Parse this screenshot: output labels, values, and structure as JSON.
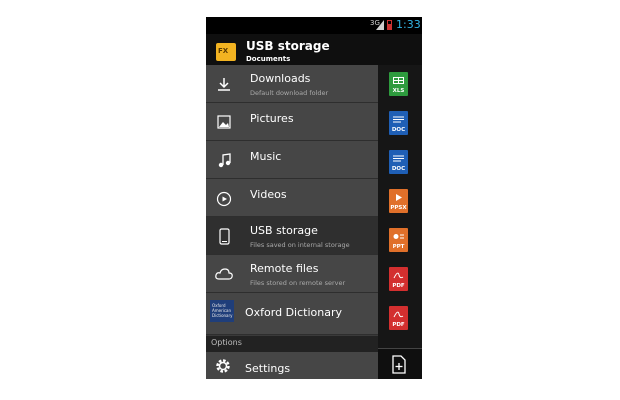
{
  "status_bar": {
    "signal": "3G",
    "time": "1:33"
  },
  "action_bar": {
    "app_icon_label": "FX",
    "title": "USB storage",
    "subtitle": "Documents"
  },
  "drawer": {
    "items": [
      {
        "label": "Downloads",
        "description": "Default download folder",
        "icon": "download-icon"
      },
      {
        "label": "Pictures",
        "description": "",
        "icon": "image-icon"
      },
      {
        "label": "Music",
        "description": "",
        "icon": "music-note-icon"
      },
      {
        "label": "Videos",
        "description": "",
        "icon": "play-circle-icon"
      },
      {
        "label": "USB storage",
        "description": "Files saved on internal storage",
        "icon": "phone-icon",
        "selected": true
      },
      {
        "label": "Remote files",
        "description": "Files stored on remote server",
        "icon": "cloud-icon"
      },
      {
        "label": "Oxford Dictionary",
        "description": "",
        "icon": "oxford-dictionary-icon",
        "icon_text": "Oxford American Dictionary"
      }
    ],
    "options_header": "Options",
    "settings_label": "Settings"
  },
  "files": [
    {
      "type": "XLS",
      "color": "#2e9b3e"
    },
    {
      "type": "DOC",
      "color": "#1f5fb5"
    },
    {
      "type": "DOC",
      "color": "#1f5fb5"
    },
    {
      "type": "PPSX",
      "color": "#e0702a"
    },
    {
      "type": "PPT",
      "color": "#e0702a"
    },
    {
      "type": "PDF",
      "color": "#d32f2f"
    },
    {
      "type": "PDF",
      "color": "#d32f2f"
    }
  ],
  "colors": {
    "accent": "#33b5e5",
    "drawer_bg": "#464646",
    "selected_bg": "#2f2f2f"
  }
}
